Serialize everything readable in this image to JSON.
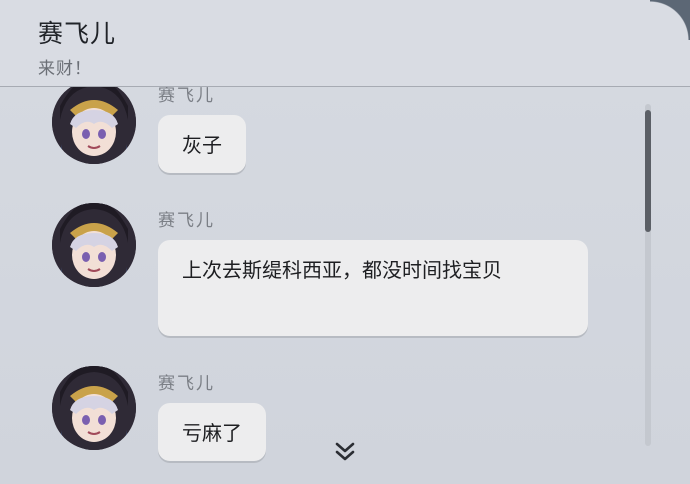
{
  "header": {
    "title": "赛飞儿",
    "subtitle": "来财！"
  },
  "messages": [
    {
      "sender": "赛飞儿",
      "text": "灰子"
    },
    {
      "sender": "赛飞儿",
      "text": "上次去斯缇科西亚，都没时间找宝贝"
    },
    {
      "sender": "赛飞儿",
      "text": "亏麻了"
    }
  ],
  "icons": {
    "scroll_down": "chevron-double-down-icon",
    "avatar": "character-avatar"
  }
}
